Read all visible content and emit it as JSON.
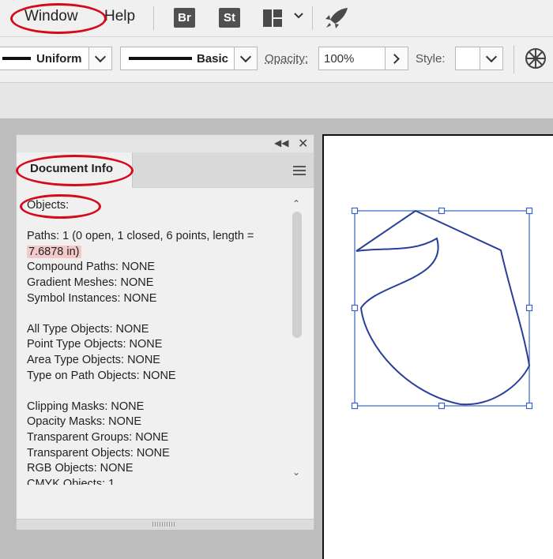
{
  "menubar": {
    "items": [
      {
        "label": "Window"
      },
      {
        "label": "Help"
      }
    ],
    "app_icons": [
      {
        "label": "Br",
        "icon": "bridge-icon"
      },
      {
        "label": "St",
        "icon": "stock-icon"
      }
    ]
  },
  "controlbar": {
    "stroke_profile": "Uniform",
    "brush": "Basic",
    "opacity_label": "Opacity:",
    "opacity_value": "100%",
    "style_label": "Style:"
  },
  "panel": {
    "tab_label": "Document Info",
    "section_label": "Objects:",
    "paths_line": "Paths: 1 (0 open, 1 closed, 6 points, length =",
    "paths_length": "7.6878 in)",
    "lines_group1": [
      "Compound Paths: NONE",
      "Gradient Meshes: NONE",
      "Symbol Instances: NONE"
    ],
    "lines_group2": [
      "All Type Objects: NONE",
      "Point Type Objects: NONE",
      "Area Type Objects: NONE",
      "Type on Path Objects: NONE"
    ],
    "lines_group3": [
      "Clipping Masks: NONE",
      "Opacity Masks: NONE",
      "Transparent Groups: NONE",
      "Transparent Objects: NONE",
      "RGB Objects: NONE",
      "CMYK Objects: 1"
    ]
  },
  "colors": {
    "highlight_ring": "#d40b1a",
    "selection": "#3a63c7",
    "path_stroke": "#2a3f9a"
  }
}
